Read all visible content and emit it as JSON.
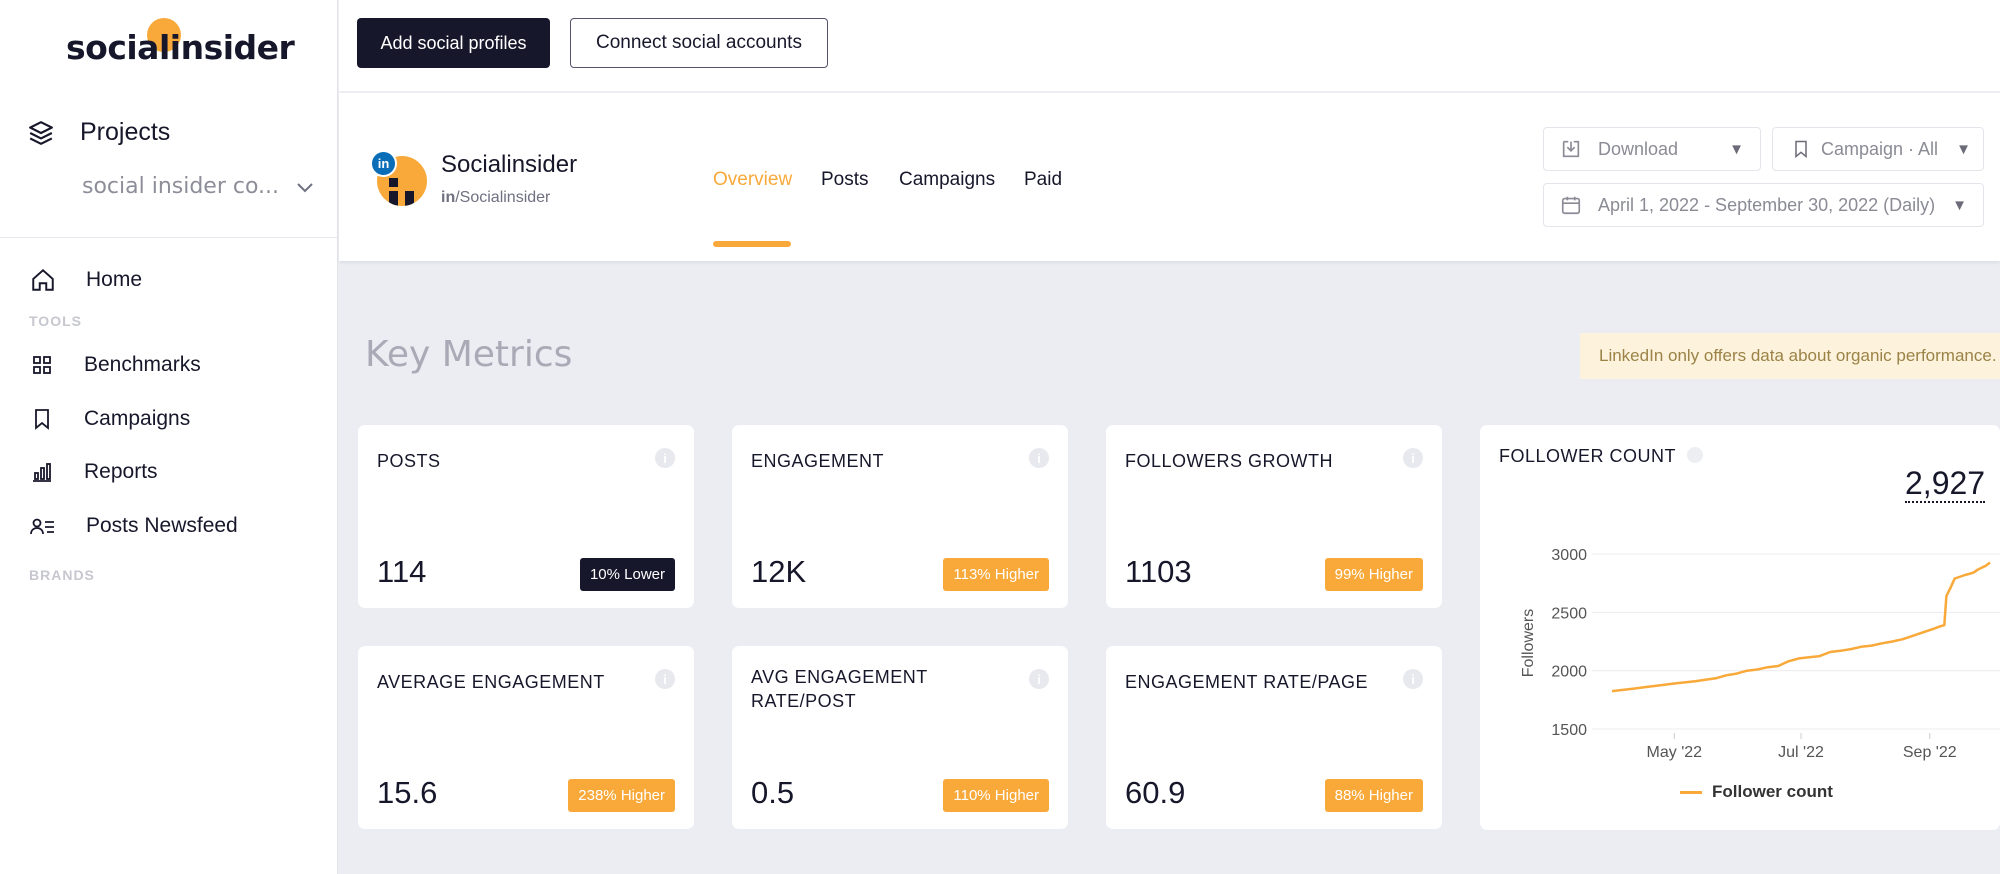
{
  "app": {
    "logo_text": "socialinsider"
  },
  "sidebar": {
    "projects_label": "Projects",
    "project_select": "social insider co...",
    "nav": [
      {
        "label": "Home"
      },
      {
        "label": "Benchmarks"
      },
      {
        "label": "Campaigns"
      },
      {
        "label": "Reports"
      },
      {
        "label": "Posts Newsfeed"
      }
    ],
    "tools_title": "TOOLS",
    "brands_title": "BRANDS"
  },
  "toolbar": {
    "add_profiles": "Add social profiles",
    "connect_accounts": "Connect social accounts"
  },
  "profile": {
    "name": "Socialinsider",
    "handle_prefix": "in",
    "handle": "/Socialinsider",
    "badge": "in",
    "tabs": [
      {
        "label": "Overview",
        "active": true
      },
      {
        "label": "Posts"
      },
      {
        "label": "Campaigns"
      },
      {
        "label": "Paid"
      }
    ],
    "download": "Download",
    "campaign": "Campaign · All",
    "date_range": "April 1, 2022 - September 30, 2022 (Daily)"
  },
  "metrics": {
    "title": "Key Metrics",
    "notice": "LinkedIn only offers data about organic performance.",
    "info_glyph": "i",
    "cards": [
      {
        "title": "POSTS",
        "value": "114",
        "badge": "10% Lower"
      },
      {
        "title": "ENGAGEMENT",
        "value": "12K",
        "badge": "113% Higher"
      },
      {
        "title": "FOLLOWERS GROWTH",
        "value": "1103",
        "badge": "99% Higher"
      },
      {
        "title": "AVERAGE ENGAGEMENT",
        "value": "15.6",
        "badge": "238% Higher"
      },
      {
        "title": "AVG ENGAGEMENT RATE/POST",
        "value": "0.5",
        "badge": "110% Higher"
      },
      {
        "title": "ENGAGEMENT RATE/PAGE",
        "value": "60.9",
        "badge": "88% Higher"
      }
    ]
  },
  "colors": {
    "accent": "#f8a93a",
    "dark": "#17172b",
    "linkedin": "#0a6db7"
  },
  "chart_data": {
    "type": "line",
    "title": "FOLLOWER COUNT",
    "headline_value": "2,927",
    "ylabel": "Followers",
    "xlabel": "",
    "ylim": [
      1500,
      3000
    ],
    "yticks": [
      "1500",
      "2000",
      "2500",
      "3000"
    ],
    "xticks": [
      {
        "label": "May '22",
        "day": 30
      },
      {
        "label": "Jul '22",
        "day": 91
      },
      {
        "label": "Sep '22",
        "day": 153
      }
    ],
    "x_range": [
      0,
      182
    ],
    "grid": true,
    "legend": "bottom",
    "series": [
      {
        "name": "Follower count",
        "points": [
          [
            0,
            1825
          ],
          [
            10,
            1845
          ],
          [
            20,
            1868
          ],
          [
            30,
            1890
          ],
          [
            40,
            1910
          ],
          [
            50,
            1935
          ],
          [
            55,
            1960
          ],
          [
            60,
            1975
          ],
          [
            65,
            2000
          ],
          [
            70,
            2010
          ],
          [
            75,
            2030
          ],
          [
            80,
            2040
          ],
          [
            85,
            2080
          ],
          [
            90,
            2105
          ],
          [
            95,
            2115
          ],
          [
            100,
            2125
          ],
          [
            105,
            2160
          ],
          [
            110,
            2170
          ],
          [
            115,
            2185
          ],
          [
            120,
            2205
          ],
          [
            125,
            2215
          ],
          [
            130,
            2235
          ],
          [
            135,
            2250
          ],
          [
            140,
            2270
          ],
          [
            145,
            2300
          ],
          [
            150,
            2330
          ],
          [
            155,
            2360
          ],
          [
            158,
            2380
          ],
          [
            160,
            2390
          ],
          [
            161,
            2640
          ],
          [
            163,
            2710
          ],
          [
            165,
            2790
          ],
          [
            170,
            2820
          ],
          [
            174,
            2840
          ],
          [
            176,
            2865
          ],
          [
            180,
            2900
          ],
          [
            182,
            2927
          ]
        ]
      }
    ]
  }
}
